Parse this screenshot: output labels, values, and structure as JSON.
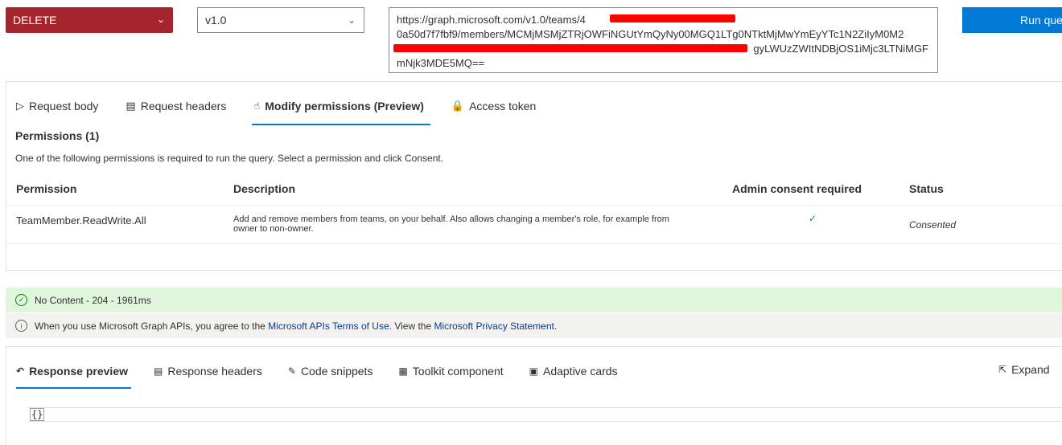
{
  "method": {
    "value": "DELETE",
    "chevron": "chevron-down-icon"
  },
  "version": {
    "value": "v1.0",
    "chevron": "chevron-down-icon"
  },
  "url": {
    "line1": "https://graph.microsoft.com/v1.0/teams/4",
    "line2": "0a50d7f7fbf9/members/MCMjMSMjZTRjOWFiNGUtYmQyNy00MGQ1LTg0NTktMjMwYmEyYTc1N2ZiIyM0M2",
    "line3": "gyLWUzZWItNDBjOS1iMjc3LTNiMGF",
    "line4": "mNjk3MDE5MQ=="
  },
  "run_button": "Run query",
  "request_tabs": [
    {
      "label": "Request body",
      "icon": "send-icon"
    },
    {
      "label": "Request headers",
      "icon": "document-icon"
    },
    {
      "label": "Modify permissions (Preview)",
      "icon": "touch-icon",
      "active": true
    },
    {
      "label": "Access token",
      "icon": "lock-icon"
    }
  ],
  "permissions": {
    "title": "Permissions (1)",
    "description": "One of the following permissions is required to run the query. Select a permission and click Consent.",
    "columns": [
      "Permission",
      "Description",
      "Admin consent required",
      "Status"
    ],
    "rows": [
      {
        "permission": "TeamMember.ReadWrite.All",
        "description_line1": "Add and remove members from teams, on your behalf. Also allows changing a member's role, for example from",
        "description_line2": "owner to non-owner.",
        "admin_consent": "✓",
        "status": "Consented"
      }
    ]
  },
  "status_success": "No Content - 204 - 1961ms",
  "info": {
    "prefix": "When you use Microsoft Graph APIs, you agree to the ",
    "link1": "Microsoft APIs Terms of Use",
    "middle": ". View the ",
    "link2": "Microsoft Privacy Statement",
    "suffix": "."
  },
  "response_tabs": [
    {
      "label": "Response preview",
      "icon": "undo-icon",
      "active": true
    },
    {
      "label": "Response headers",
      "icon": "document-icon"
    },
    {
      "label": "Code snippets",
      "icon": "code-icon"
    },
    {
      "label": "Toolkit component",
      "icon": "toolkit-icon"
    },
    {
      "label": "Adaptive cards",
      "icon": "card-icon"
    }
  ],
  "expand_label": "Expand",
  "response_body": "{}",
  "colors": {
    "method_bg": "#a4262c",
    "accent": "#0078d4",
    "success_bg": "#dff6dd",
    "info_bg": "#f3f2f1",
    "redaction": "#ff0000"
  }
}
